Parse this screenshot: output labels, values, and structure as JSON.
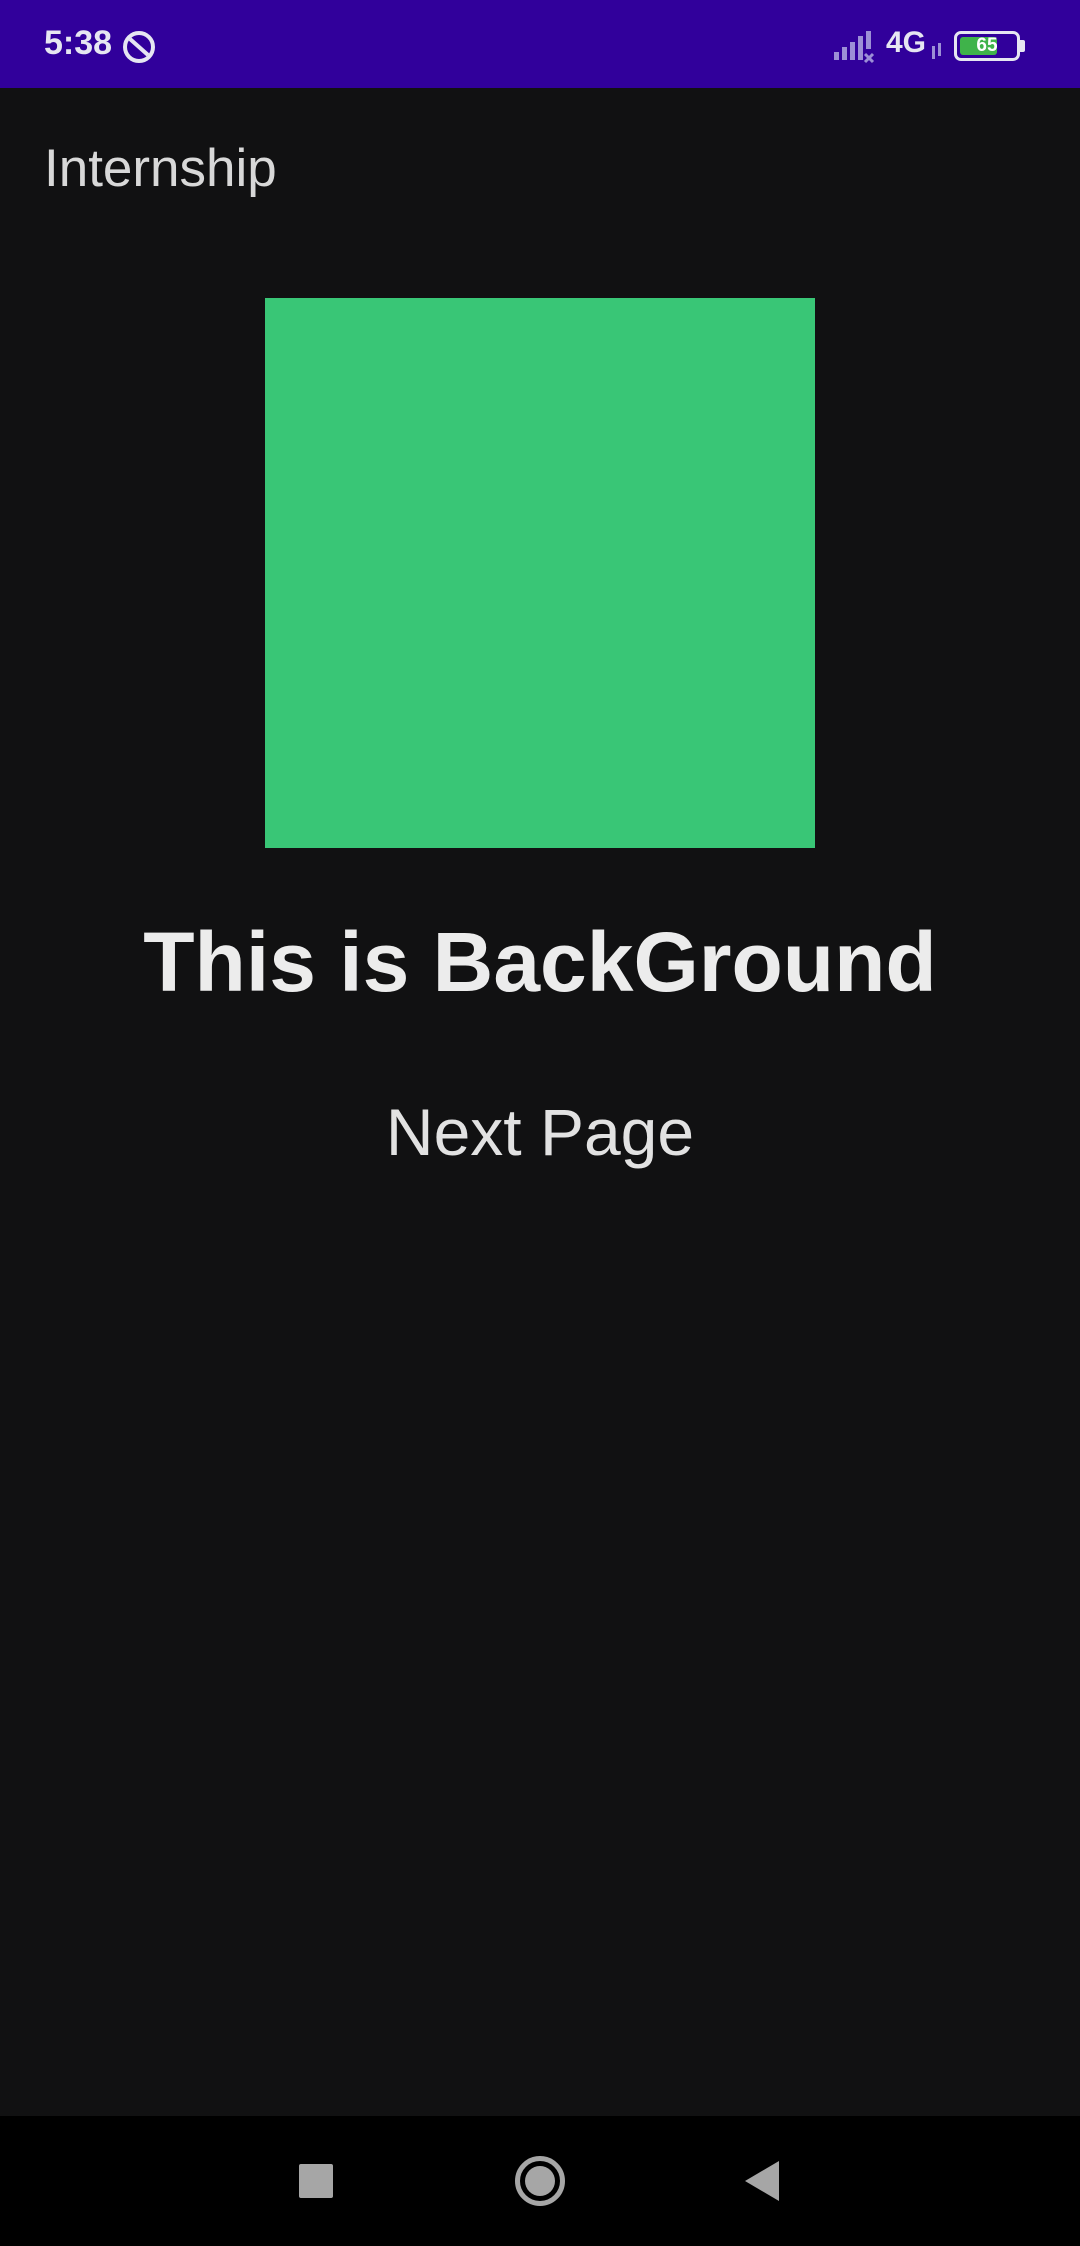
{
  "status_bar": {
    "time": "5:38",
    "network": "4G",
    "battery_level": "65",
    "background_color": "#31009b",
    "icons": [
      "do-not-disturb-icon",
      "signal-icon",
      "network-activity-icon",
      "battery-icon"
    ]
  },
  "app_bar": {
    "title": "Internship"
  },
  "main": {
    "image_icon": "green-grid-image",
    "image_color": "#39c676",
    "headline": "This is BackGround",
    "next_button_label": "Next Page"
  },
  "nav_bar": {
    "icons": [
      "recents-icon",
      "home-icon",
      "back-icon"
    ]
  }
}
